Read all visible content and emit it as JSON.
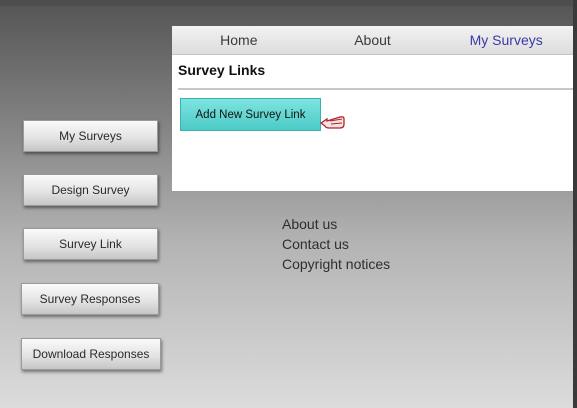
{
  "nav": {
    "tabs": [
      {
        "label": "Home"
      },
      {
        "label": "About"
      },
      {
        "label": "My Surveys",
        "active": true
      }
    ]
  },
  "sidebar": {
    "items": [
      {
        "label": "My Surveys"
      },
      {
        "label": "Design Survey"
      },
      {
        "label": "Survey Link"
      },
      {
        "label": "Survey Responses"
      },
      {
        "label": "Download Responses"
      }
    ]
  },
  "main": {
    "title": "Survey Links",
    "add_button_label": "Add New Survey Link",
    "cursor_icon": "hand-pointer-icon"
  },
  "footer": {
    "links": [
      "About us",
      "Contact us",
      "Copyright notices"
    ]
  },
  "colors": {
    "active_tab": "#3a3aa8",
    "add_button": "#5fd6d2"
  }
}
